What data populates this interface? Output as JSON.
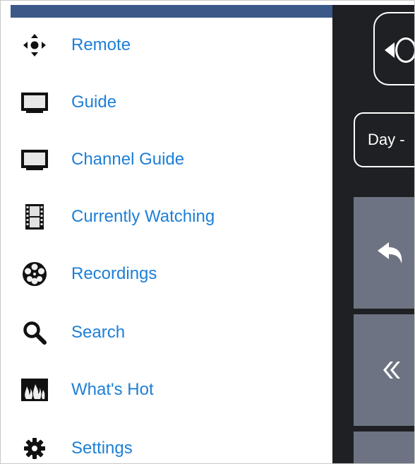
{
  "menu": {
    "items": [
      {
        "label": "Remote",
        "icon": "remote-dpad-icon"
      },
      {
        "label": "Guide",
        "icon": "tv-icon"
      },
      {
        "label": "Channel Guide",
        "icon": "tv-icon"
      },
      {
        "label": "Currently Watching",
        "icon": "film-strip-icon"
      },
      {
        "label": "Recordings",
        "icon": "film-reel-icon"
      },
      {
        "label": "Search",
        "icon": "search-icon"
      },
      {
        "label": "What's Hot",
        "icon": "flames-icon"
      },
      {
        "label": "Settings",
        "icon": "gear-icon"
      }
    ]
  },
  "right_panel": {
    "day_label": "Day -"
  },
  "colors": {
    "header_bar": "#3b5888",
    "label_blue": "#1d7fd6",
    "panel_dark": "#1f2023",
    "panel_button": "#6d7382"
  }
}
